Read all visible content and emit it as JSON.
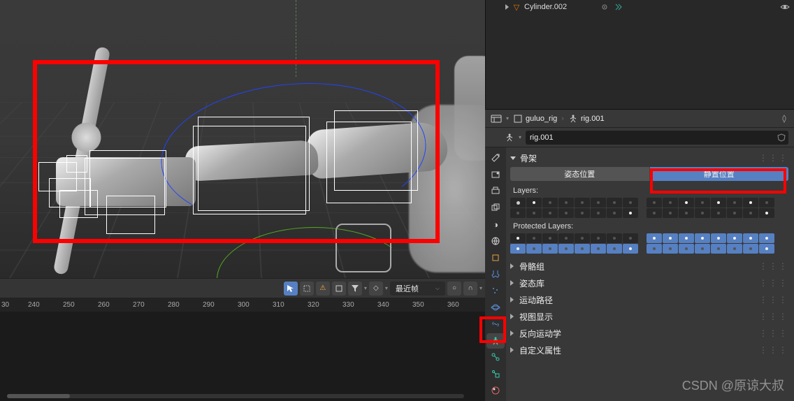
{
  "outliner": {
    "item1": {
      "label": "Cylinder.002"
    }
  },
  "breadcrumb": {
    "scene": "guluo_rig",
    "object": "rig.001"
  },
  "datablock": {
    "name": "rig.001"
  },
  "armature": {
    "header": "骨架",
    "pose_position": "姿态位置",
    "rest_position": "静置位置",
    "layers_label": "Layers:",
    "protected_label": "Protected Layers:"
  },
  "panels": {
    "bone_groups": "骨骼组",
    "pose_library": "姿态库",
    "motion_paths": "运动路径",
    "viewport_display": "视图显示",
    "inverse_kinematics": "反向运动学",
    "custom_props": "自定义属性"
  },
  "timeline": {
    "snap_mode": "最近帧",
    "ticks": [
      "30",
      "240",
      "250",
      "260",
      "270",
      "280",
      "290",
      "300",
      "310",
      "320",
      "330",
      "340",
      "350",
      "360"
    ]
  },
  "watermark": "CSDN @原谅大叔"
}
